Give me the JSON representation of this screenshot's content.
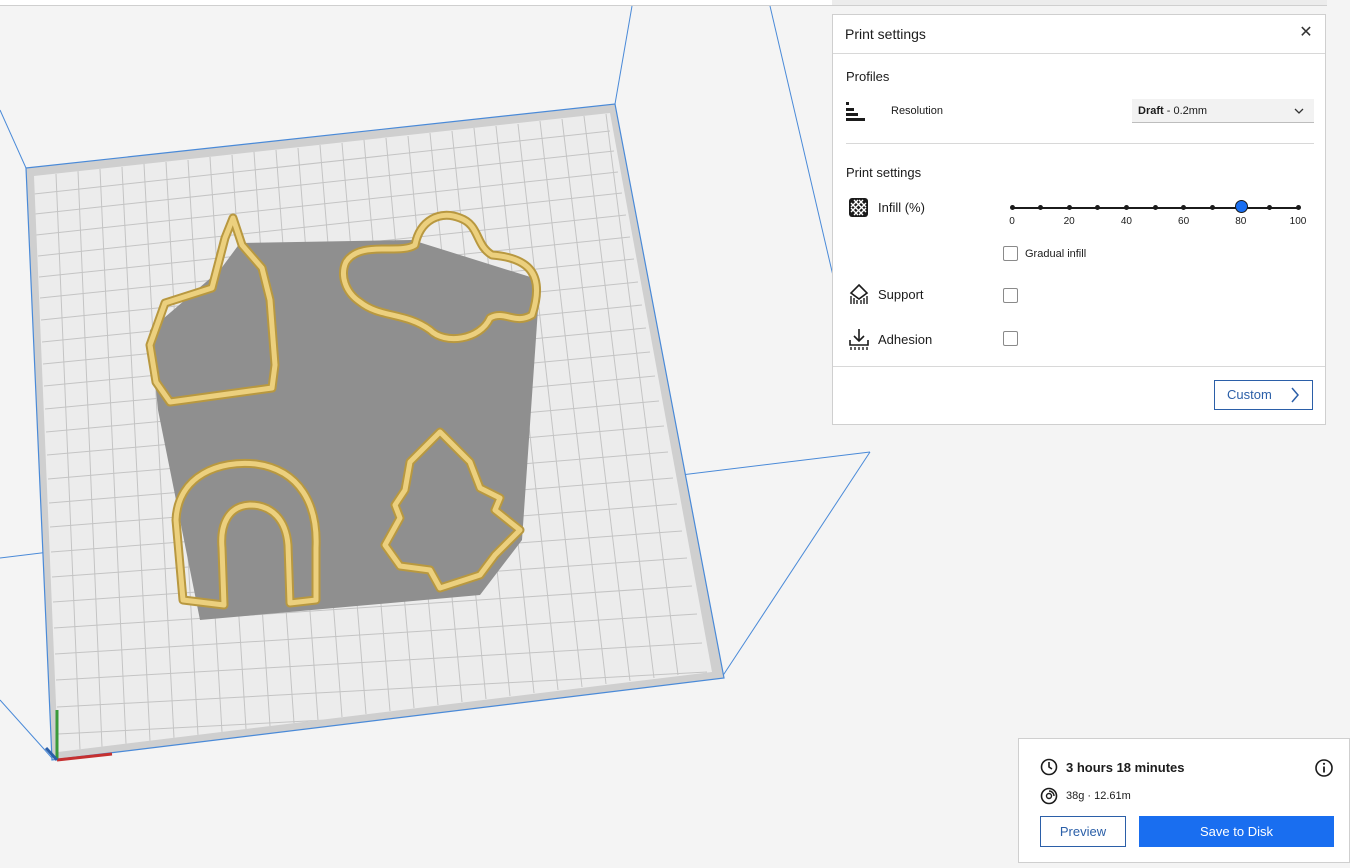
{
  "print_settings": {
    "title": "Print settings",
    "close_icon": "close-icon",
    "profiles_label": "Profiles",
    "resolution_label": "Resolution",
    "resolution_value_bold": "Draft",
    "resolution_value_rest": " - 0.2mm",
    "section_label": "Print settings",
    "infill": {
      "label": "Infill (%)",
      "value": 80,
      "ticks": [
        "0",
        "20",
        "40",
        "60",
        "80",
        "100"
      ]
    },
    "gradual_infill_label": "Gradual infill",
    "gradual_infill_checked": false,
    "support_label": "Support",
    "support_checked": false,
    "adhesion_label": "Adhesion",
    "adhesion_checked": false,
    "custom_label": "Custom"
  },
  "job": {
    "time": "3 hours 18 minutes",
    "material": "38g · 12.61m",
    "preview_label": "Preview",
    "save_label": "Save to Disk"
  },
  "colors": {
    "accent": "#196ef0",
    "model": "#e8c874",
    "build_plate": "#ececec"
  }
}
